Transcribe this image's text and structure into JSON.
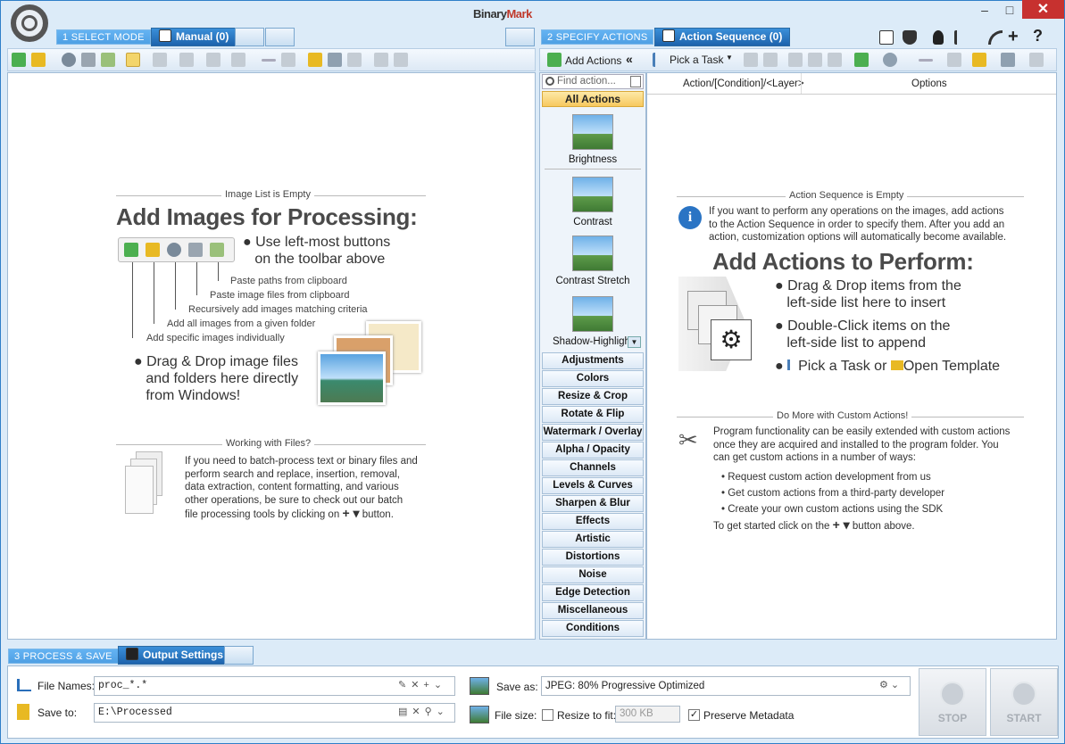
{
  "app": {
    "logo_a": "Binary",
    "logo_b": "Mark"
  },
  "window": {
    "min": "–",
    "max": "□",
    "close": "✕"
  },
  "steps": {
    "select_mode": "1  SELECT MODE",
    "specify_actions": "2  SPECIFY ACTIONS",
    "process_save": "3  PROCESS & SAVE"
  },
  "tabs": {
    "manual": "Manual (0)",
    "action_sequence": "Action Sequence (0)",
    "output_settings": "Output Settings"
  },
  "left": {
    "empty_caption": "Image List is Empty",
    "heading": "Add Images for Processing:",
    "bullet1a": "Use left-most buttons",
    "bullet1b": "on the toolbar above",
    "callouts": [
      "Paste paths from clipboard",
      "Paste image files from clipboard",
      "Recursively add images matching criteria",
      "Add all images from a given folder",
      "Add specific images individually"
    ],
    "drag1": "Drag & Drop image files",
    "drag2": "and folders here directly",
    "drag3": "from Windows!",
    "files_caption": "Working with Files?",
    "files_text": [
      "If you need to batch-process text or binary files and",
      "perform search and replace, insertion, removal,",
      "data extraction, content formatting, and various",
      "other operations, be sure to check out our batch",
      "file processing tools by clicking on",
      "button."
    ]
  },
  "actions_toolbar": {
    "add_actions": "Add Actions",
    "collapse": "«",
    "pick_task": "Pick a Task"
  },
  "find": {
    "placeholder": "Find action..."
  },
  "action_list": {
    "all_actions": "All Actions",
    "tiles": [
      "Brightness",
      "Contrast",
      "Contrast Stretch",
      "Shadow-Highligh"
    ],
    "categories": [
      "Adjustments",
      "Colors",
      "Resize & Crop",
      "Rotate & Flip",
      "Watermark / Overlay",
      "Alpha / Opacity",
      "Channels",
      "Levels & Curves",
      "Sharpen & Blur",
      "Effects",
      "Artistic",
      "Distortions",
      "Noise",
      "Edge Detection",
      "Miscellaneous",
      "Conditions"
    ]
  },
  "grid": {
    "col1": "Action/[Condition]/<Layer>",
    "col2": "Options"
  },
  "right": {
    "empty_caption": "Action Sequence is Empty",
    "info": [
      "If you want to perform any operations on the images, add actions",
      "to the Action Sequence in order to specify them. After you add an",
      "action, customization options will automatically become available."
    ],
    "heading": "Add Actions to Perform:",
    "b1a": "Drag & Drop items from the",
    "b1b": "left-side list here to insert",
    "b2a": "Double-Click items on the",
    "b2b": "left-side list to append",
    "b3a": "Pick a Task or",
    "b3b": "Open Template",
    "custom_caption": "Do More with Custom Actions!",
    "custom_text": [
      "Program functionality can be easily extended with custom actions",
      "once they are acquired and installed to the program folder. You",
      "can get custom actions in a number of ways:"
    ],
    "ways": [
      "Request custom action development from us",
      "Get custom actions from a third-party developer",
      "Create your own custom actions using the SDK"
    ],
    "start_a": "To get started click on the",
    "start_b": "button above."
  },
  "output": {
    "file_names_label": "File Names:",
    "file_names_value": "proc_*.*",
    "save_to_label": "Save to:",
    "save_to_value": "E:\\Processed",
    "save_as_label": "Save as:",
    "save_as_value": "JPEG: 80%  Progressive Optimized",
    "file_size_label": "File size:",
    "resize_label": "Resize to fit:",
    "resize_value": "300 KB",
    "resize_checked": false,
    "preserve_label": "Preserve Metadata",
    "preserve_checked": true,
    "stop": "STOP",
    "start": "START"
  }
}
